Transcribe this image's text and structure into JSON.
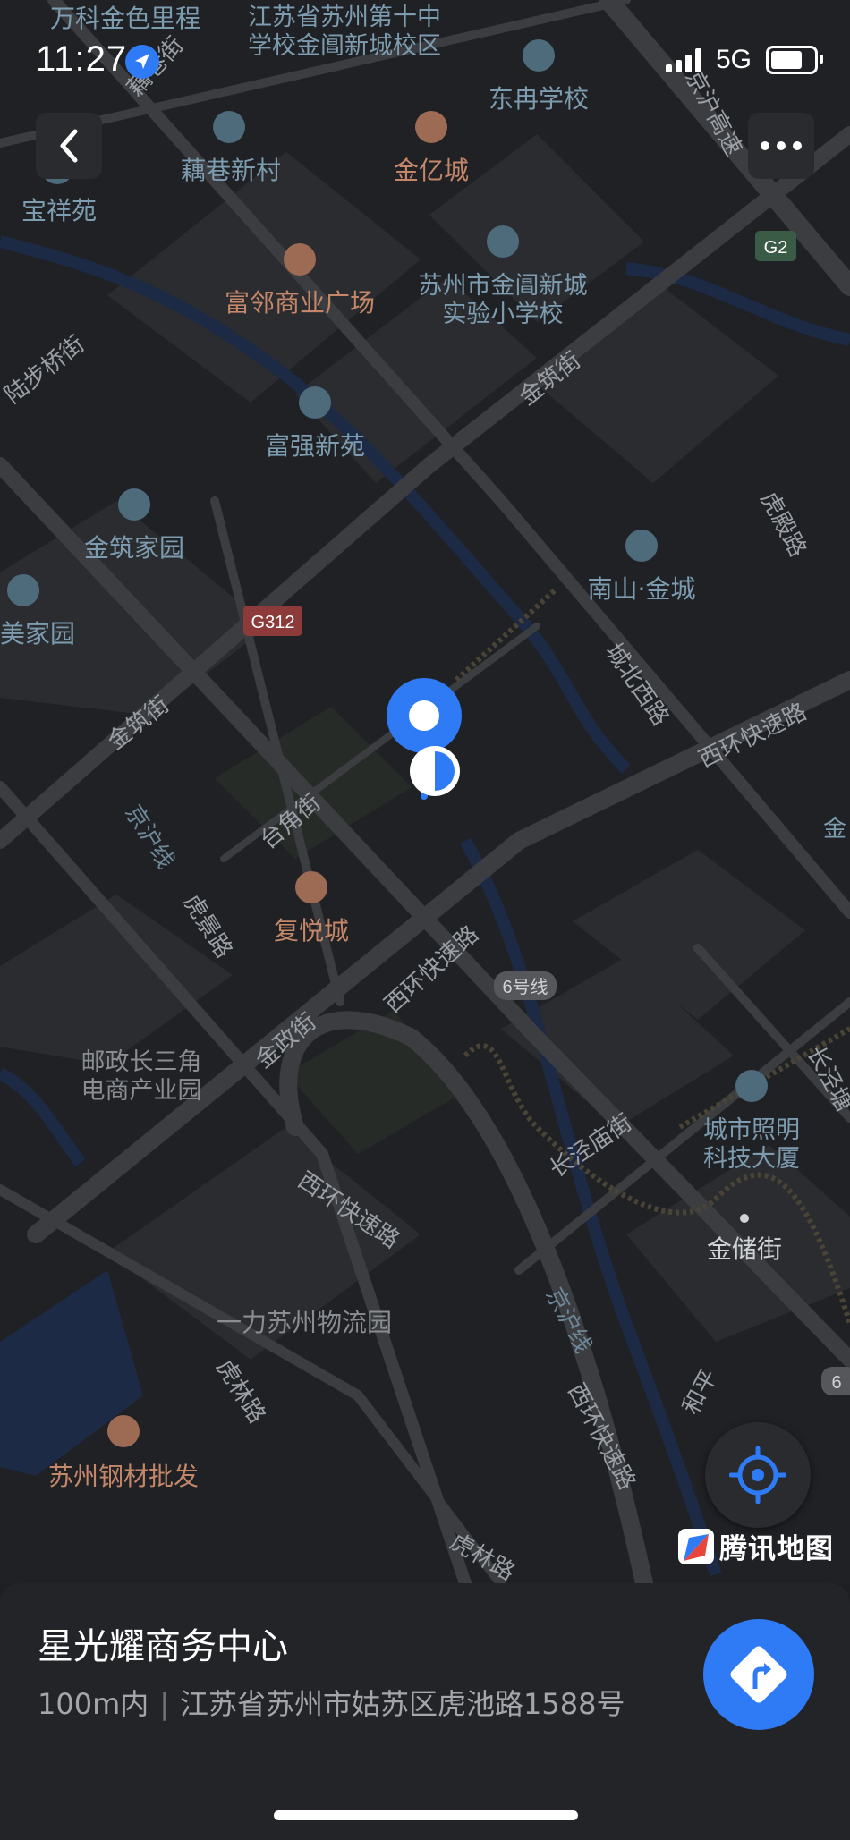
{
  "status_bar": {
    "time": "11:27",
    "network": "5G",
    "battery_level": 0.8
  },
  "map": {
    "places": [
      {
        "name": "万科金色里程",
        "type": "residential",
        "color": "#7d9cb0"
      },
      {
        "name": "江苏省苏州第十中学校金阊新城校区",
        "type": "school",
        "color": "#7d9cb0"
      },
      {
        "name": "东冉学校",
        "type": "school",
        "color": "#7d9cb0"
      },
      {
        "name": "藕巷新村",
        "type": "residential",
        "color": "#7d9cb0"
      },
      {
        "name": "金亿城",
        "type": "shopping",
        "color": "#c5876a"
      },
      {
        "name": "宝祥苑",
        "type": "residential",
        "color": "#7d9cb0"
      },
      {
        "name": "富邻商业广场",
        "type": "shopping",
        "color": "#c5876a"
      },
      {
        "name": "苏州市金阊新城实验小学校",
        "type": "school",
        "color": "#7d9cb0"
      },
      {
        "name": "富强新苑",
        "type": "residential",
        "color": "#7d9cb0"
      },
      {
        "name": "金筑家园",
        "type": "residential",
        "color": "#7d9cb0"
      },
      {
        "name": "南山·金城",
        "type": "residential",
        "color": "#7d9cb0"
      },
      {
        "name": "美家园",
        "type": "residential",
        "color": "#7d9cb0"
      },
      {
        "name": "复悦城",
        "type": "shopping",
        "color": "#c5876a"
      },
      {
        "name": "邮政长三角电商产业园",
        "type": "label",
        "color": "#8a8d92"
      },
      {
        "name": "城市照明科技大厦",
        "type": "office",
        "color": "#7d9cb0"
      },
      {
        "name": "金储街",
        "type": "street",
        "color": "#cfd2d6"
      },
      {
        "name": "一力苏州物流园",
        "type": "label",
        "color": "#8a8d92"
      },
      {
        "name": "苏州钢材批发",
        "type": "shopping",
        "color": "#c5876a"
      }
    ],
    "roads": [
      "藕巷街",
      "京沪高速",
      "陆步桥街",
      "金筑街",
      "虎殿路",
      "城北西路",
      "西环快速路",
      "台角街",
      "京沪线",
      "虎景路",
      "金政街",
      "长泾庙街",
      "长泾塘",
      "和平",
      "虎林路"
    ],
    "shields": [
      "G2",
      "G312",
      "6号线"
    ],
    "edge_labels": [
      "金",
      "6"
    ]
  },
  "buttons": {
    "back": "back",
    "more": "more",
    "locate": "locate",
    "navigate": "navigate"
  },
  "watermark": "腾讯地图",
  "bottom_sheet": {
    "title": "星光耀商务中心",
    "distance": "100m内",
    "separator": "|",
    "address": "江苏省苏州市姑苏区虎池路1588号"
  },
  "colors": {
    "accent": "#2f7bf6",
    "background": "#1d1f22",
    "sheet": "#232427"
  }
}
